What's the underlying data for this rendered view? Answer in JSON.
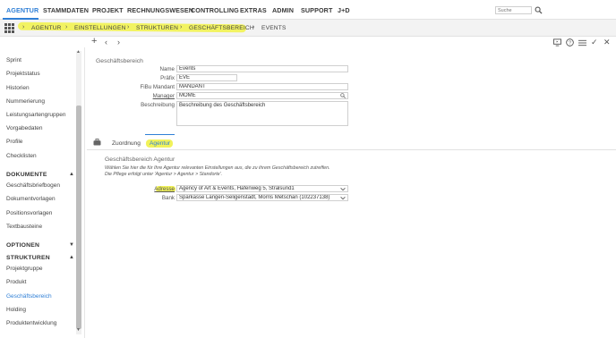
{
  "topnav": {
    "items": [
      "AGENTUR",
      "STAMMDATEN",
      "PROJEKT",
      "RECHNUNGSWESEN",
      "CONTROLLING",
      "EXTRAS",
      "ADMIN",
      "SUPPORT",
      "J+D"
    ],
    "active": "AGENTUR",
    "search_placeholder": "Suche"
  },
  "breadcrumb": [
    "AGENTUR",
    "EINSTELLUNGEN",
    "STRUKTUREN",
    "GESCHÄFTSBEREICH",
    "EVENTS"
  ],
  "sidebar": {
    "top_items": [
      "Sprint",
      "Projektstatus",
      "Historien",
      "Nummerierung",
      "Leistungsartengruppen",
      "Vorgabedaten",
      "Profile",
      "Checklisten"
    ],
    "sections": [
      {
        "label": "DOKUMENTE",
        "items": [
          "Geschäftsbriefbogen",
          "Dokumentvorlagen",
          "Positionsvorlagen",
          "Textbausteine"
        ]
      },
      {
        "label": "OPTIONEN",
        "items": []
      },
      {
        "label": "STRUKTUREN",
        "items": [
          "Projektgruppe",
          "Produkt",
          "Geschäftsbereich",
          "Holding",
          "Produktentwicklung"
        ]
      }
    ],
    "active_item": "Geschäftsbereich"
  },
  "form": {
    "title": "Geschäftsbereich",
    "fields": {
      "name": {
        "label": "Name",
        "value": "Events"
      },
      "prefix": {
        "label": "Präfix",
        "value": "EVE"
      },
      "fibu": {
        "label": "FiBu Mandant",
        "value": "MANDANT"
      },
      "manager": {
        "label": "Manager",
        "value": "MOME"
      },
      "description": {
        "label": "Beschreibung",
        "value": "Beschreibung des Geschäftsbereich"
      }
    }
  },
  "tabs": [
    "Zuordnung",
    "Agentur"
  ],
  "active_tab": "Agentur",
  "agentur": {
    "title": "Geschäftsbereich Agentur",
    "note1": "Wählen Sie hier die für Ihre Agentur relevanten Einstellungen aus, die zu ihrem Geschäftsbereich zutreffen.",
    "note2": "Die Pflege erfolgt unter 'Agentur > Agentur > Standorte'.",
    "adresse": {
      "label": "Adresse",
      "value": "Agency of Art & Events, Hafenweg 5, Stralsund1"
    },
    "bank": {
      "label": "Bank",
      "value": "Sparkasse Langen-Seligenstadt, Morris Metschan (102237138)"
    }
  },
  "icons": [
    "grid-icon",
    "search-icon",
    "add-icon",
    "back-icon",
    "forward-icon",
    "monitor-icon",
    "help-icon",
    "list-icon",
    "check-icon",
    "close-icon",
    "briefcase-icon",
    "magnifier-icon",
    "chevron-down-icon"
  ],
  "colors": {
    "accent": "#2f7fd6",
    "highlight": "#f1f25a"
  }
}
